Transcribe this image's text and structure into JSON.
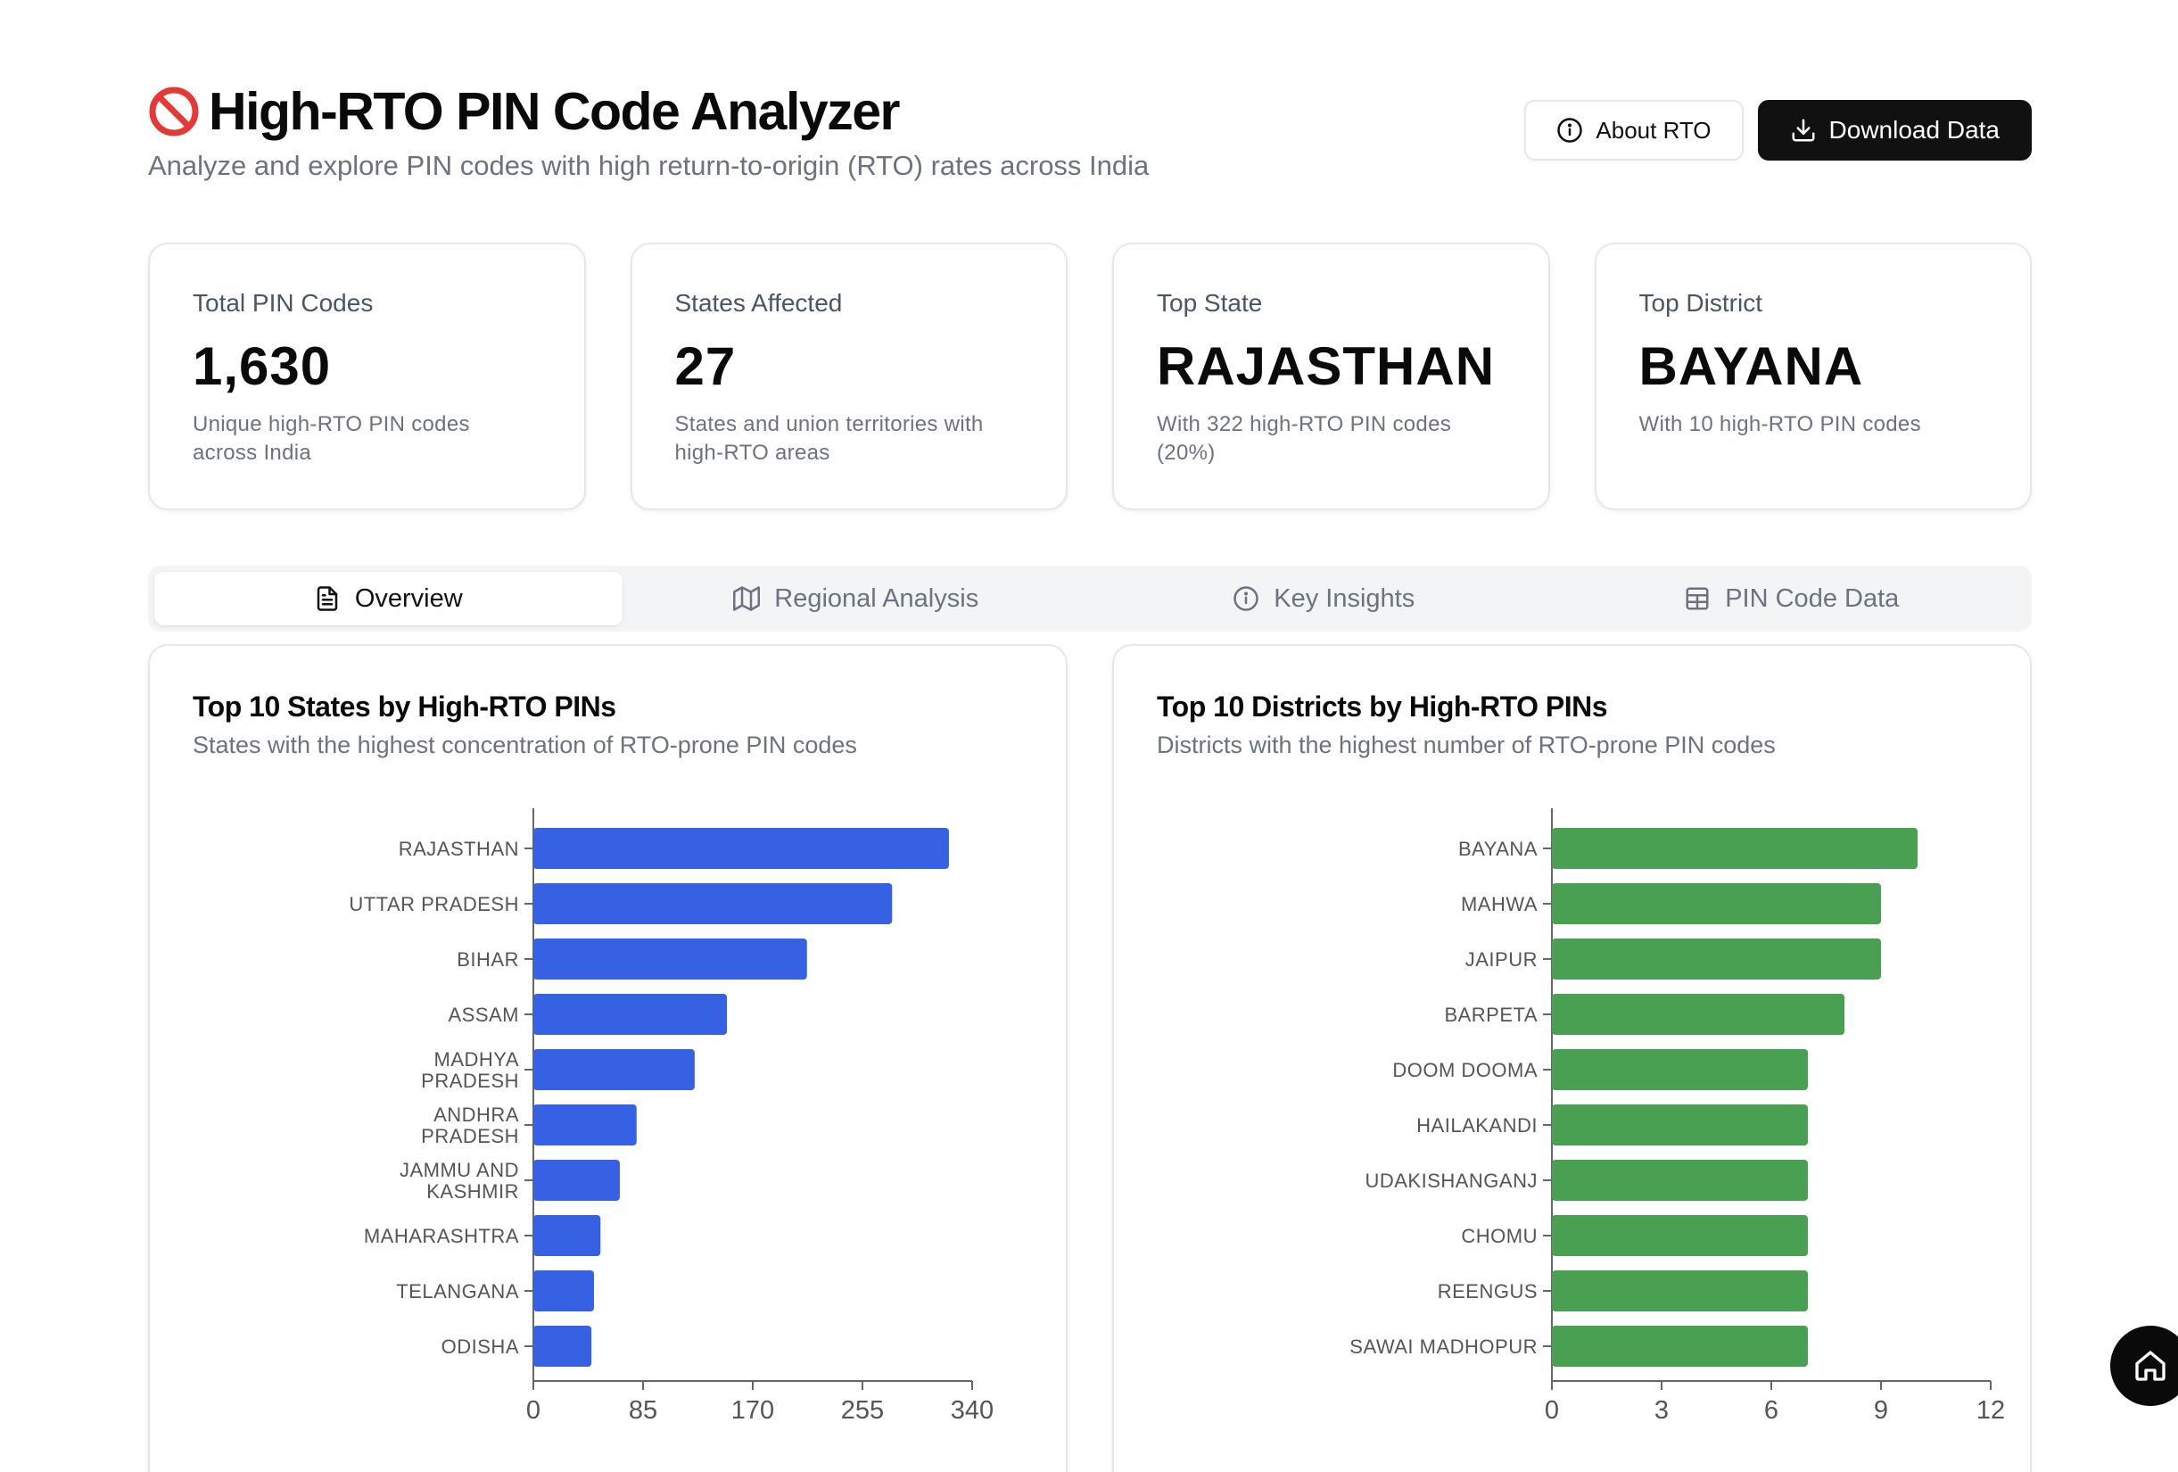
{
  "header": {
    "title": "High-RTO PIN Code Analyzer",
    "subtitle": "Analyze and explore PIN codes with high return-to-origin (RTO) rates across India",
    "title_icon": "prohibited-icon",
    "about_label": "About RTO",
    "download_label": "Download Data"
  },
  "stats": [
    {
      "label": "Total PIN Codes",
      "value": "1,630",
      "desc_line1": "Unique high-RTO PIN codes",
      "desc_line2": "across India"
    },
    {
      "label": "States Affected",
      "value": "27",
      "desc_line1": "States and union territories with",
      "desc_line2": "high-RTO areas"
    },
    {
      "label": "Top State",
      "value": "RAJASTHAN",
      "desc_line1": "With 322 high-RTO PIN codes",
      "desc_line2": "(20%)"
    },
    {
      "label": "Top District",
      "value": "BAYANA",
      "desc_line1": "With 10 high-RTO PIN codes",
      "desc_line2": ""
    }
  ],
  "tabs": [
    {
      "label": "Overview",
      "icon": "document-icon",
      "active": true
    },
    {
      "label": "Regional Analysis",
      "icon": "map-icon",
      "active": false
    },
    {
      "label": "Key Insights",
      "icon": "info-icon",
      "active": false
    },
    {
      "label": "PIN Code Data",
      "icon": "table-icon",
      "active": false
    }
  ],
  "colors": {
    "states_bar": "#3661e3",
    "districts_bar": "#4aa052",
    "accent_dark": "#111111"
  },
  "chart_data": [
    {
      "type": "bar",
      "orientation": "horizontal",
      "title": "Top 10 States by High-RTO PINs",
      "subtitle": "States with the highest concentration of RTO-prone PIN codes",
      "categories": [
        [
          "RAJASTHAN"
        ],
        [
          "UTTAR PRADESH"
        ],
        [
          "BIHAR"
        ],
        [
          "ASSAM"
        ],
        [
          "MADHYA",
          "PRADESH"
        ],
        [
          "ANDHRA",
          "PRADESH"
        ],
        [
          "JAMMU AND",
          "KASHMIR"
        ],
        [
          "MAHARASHTRA"
        ],
        [
          "TELANGANA"
        ],
        [
          "ODISHA"
        ]
      ],
      "values": [
        322,
        278,
        212,
        150,
        125,
        80,
        67,
        52,
        47,
        45
      ],
      "xlim": [
        0,
        340
      ],
      "xticks": [
        "0",
        "85",
        "170",
        "255",
        "340"
      ],
      "grid": false,
      "color": "#3661e3"
    },
    {
      "type": "bar",
      "orientation": "horizontal",
      "title": "Top 10 Districts by High-RTO PINs",
      "subtitle": "Districts with the highest number of RTO-prone PIN codes",
      "categories": [
        [
          "BAYANA"
        ],
        [
          "MAHWA"
        ],
        [
          "JAIPUR"
        ],
        [
          "BARPETA"
        ],
        [
          "DOOM DOOMA"
        ],
        [
          "HAILAKANDI"
        ],
        [
          "UDAKISHANGANJ"
        ],
        [
          "CHOMU"
        ],
        [
          "REENGUS"
        ],
        [
          "SAWAI MADHOPUR"
        ]
      ],
      "values": [
        10,
        9,
        9,
        8,
        7,
        7,
        7,
        7,
        7,
        7
      ],
      "xlim": [
        0,
        12
      ],
      "xticks": [
        "0",
        "3",
        "6",
        "9",
        "12"
      ],
      "grid": false,
      "color": "#4aa052"
    }
  ],
  "fab": {
    "icon": "home-icon"
  }
}
